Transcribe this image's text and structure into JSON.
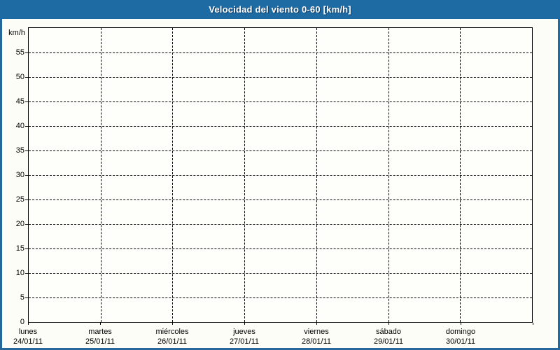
{
  "window": {
    "title": "Velocidad del viento 0-60 [km/h]"
  },
  "colors": {
    "header-bg": "#1e6aa3",
    "header-text": "#ffffff",
    "title-shadow": "#0f3a63",
    "frame-border": "#26689c",
    "page-bg": "#fdfdf8",
    "plot-bg": "#fefefa",
    "plot-border": "#000000",
    "grid-color": "#000000",
    "label-color": "#000000"
  },
  "chart_data": {
    "type": "line",
    "title": "Velocidad del viento 0-60 [km/h]",
    "ylabel": "km/h",
    "ylim": [
      0,
      60
    ],
    "ytick_interval": 5,
    "yticks": [
      0,
      5,
      10,
      15,
      20,
      25,
      30,
      35,
      40,
      45,
      50,
      55
    ],
    "x_axis": {
      "days": [
        {
          "name": "lunes",
          "date": "24/01/11"
        },
        {
          "name": "martes",
          "date": "25/01/11"
        },
        {
          "name": "miércoles",
          "date": "26/01/11"
        },
        {
          "name": "jueves",
          "date": "27/01/11"
        },
        {
          "name": "viernes",
          "date": "28/01/11"
        },
        {
          "name": "sábado",
          "date": "29/01/11"
        },
        {
          "name": "domingo",
          "date": "30/01/11"
        }
      ]
    },
    "grid": "dashed",
    "legend": "none",
    "series": []
  }
}
